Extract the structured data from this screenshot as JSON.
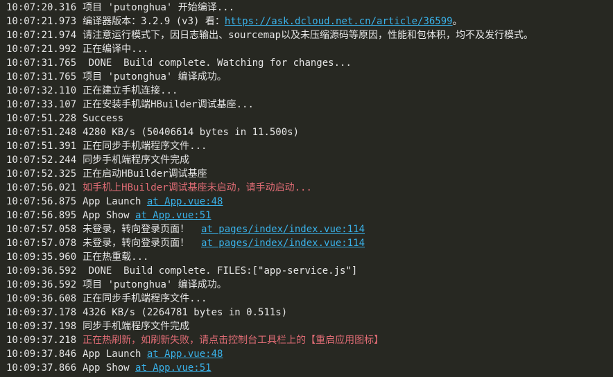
{
  "logs": [
    {
      "time": "10:07:20.316",
      "text": "项目 'putonghua' 开始编译...",
      "link": "",
      "tail": "",
      "tone": "normal"
    },
    {
      "time": "10:07:21.973",
      "text": "编译器版本：3.2.9 (v3) 看：",
      "link": "https://ask.dcloud.net.cn/article/36599",
      "tail": "。",
      "tone": "normal"
    },
    {
      "time": "10:07:21.974",
      "text": "请注意运行模式下，因日志输出、sourcemap以及未压缩源码等原因，性能和包体积，均不及发行模式。",
      "link": "",
      "tail": "",
      "tone": "normal"
    },
    {
      "time": "10:07:21.992",
      "text": "正在编译中...",
      "link": "",
      "tail": "",
      "tone": "normal"
    },
    {
      "time": "10:07:31.765",
      "text": " DONE  Build complete. Watching for changes...",
      "link": "",
      "tail": "",
      "tone": "normal"
    },
    {
      "time": "10:07:31.765",
      "text": "项目 'putonghua' 编译成功。",
      "link": "",
      "tail": "",
      "tone": "normal"
    },
    {
      "time": "10:07:32.110",
      "text": "正在建立手机连接...",
      "link": "",
      "tail": "",
      "tone": "normal"
    },
    {
      "time": "10:07:33.107",
      "text": "正在安装手机端HBuilder调试基座...",
      "link": "",
      "tail": "",
      "tone": "normal"
    },
    {
      "time": "10:07:51.228",
      "text": "Success",
      "link": "",
      "tail": "",
      "tone": "normal"
    },
    {
      "time": "10:07:51.248",
      "text": "4280 KB/s (50406614 bytes in 11.500s)",
      "link": "",
      "tail": "",
      "tone": "normal"
    },
    {
      "time": "10:07:51.391",
      "text": "正在同步手机端程序文件...",
      "link": "",
      "tail": "",
      "tone": "normal"
    },
    {
      "time": "10:07:52.244",
      "text": "同步手机端程序文件完成",
      "link": "",
      "tail": "",
      "tone": "normal"
    },
    {
      "time": "10:07:52.325",
      "text": "正在启动HBuilder调试基座",
      "link": "",
      "tail": "",
      "tone": "normal"
    },
    {
      "time": "10:07:56.021",
      "text": "如手机上HBuilder调试基座未启动，请手动启动...",
      "link": "",
      "tail": "",
      "tone": "warn"
    },
    {
      "time": "10:07:56.875",
      "text": "App Launch ",
      "link": "at App.vue:48",
      "tail": "",
      "tone": "normal"
    },
    {
      "time": "10:07:56.895",
      "text": "App Show ",
      "link": "at App.vue:51",
      "tail": "",
      "tone": "normal"
    },
    {
      "time": "10:07:57.058",
      "text": "未登录，转向登录页面！  ",
      "link": "at pages/index/index.vue:114",
      "tail": "",
      "tone": "normal"
    },
    {
      "time": "10:07:57.078",
      "text": "未登录，转向登录页面！  ",
      "link": "at pages/index/index.vue:114",
      "tail": "",
      "tone": "normal"
    },
    {
      "time": "10:09:35.960",
      "text": "正在热重载...",
      "link": "",
      "tail": "",
      "tone": "normal"
    },
    {
      "time": "10:09:36.592",
      "text": " DONE  Build complete. FILES:[\"app-service.js\"]",
      "link": "",
      "tail": "",
      "tone": "normal"
    },
    {
      "time": "10:09:36.592",
      "text": "项目 'putonghua' 编译成功。",
      "link": "",
      "tail": "",
      "tone": "normal"
    },
    {
      "time": "10:09:36.608",
      "text": "正在同步手机端程序文件...",
      "link": "",
      "tail": "",
      "tone": "normal"
    },
    {
      "time": "10:09:37.178",
      "text": "4326 KB/s (2264781 bytes in 0.511s)",
      "link": "",
      "tail": "",
      "tone": "normal"
    },
    {
      "time": "10:09:37.198",
      "text": "同步手机端程序文件完成",
      "link": "",
      "tail": "",
      "tone": "normal"
    },
    {
      "time": "10:09:37.218",
      "text": "正在热刷新，如刷新失败，请点击控制台工具栏上的【重启应用图标】",
      "link": "",
      "tail": "",
      "tone": "warn"
    },
    {
      "time": "10:09:37.846",
      "text": "App Launch ",
      "link": "at App.vue:48",
      "tail": "",
      "tone": "normal"
    },
    {
      "time": "10:09:37.866",
      "text": "App Show ",
      "link": "at App.vue:51",
      "tail": "",
      "tone": "normal"
    }
  ]
}
